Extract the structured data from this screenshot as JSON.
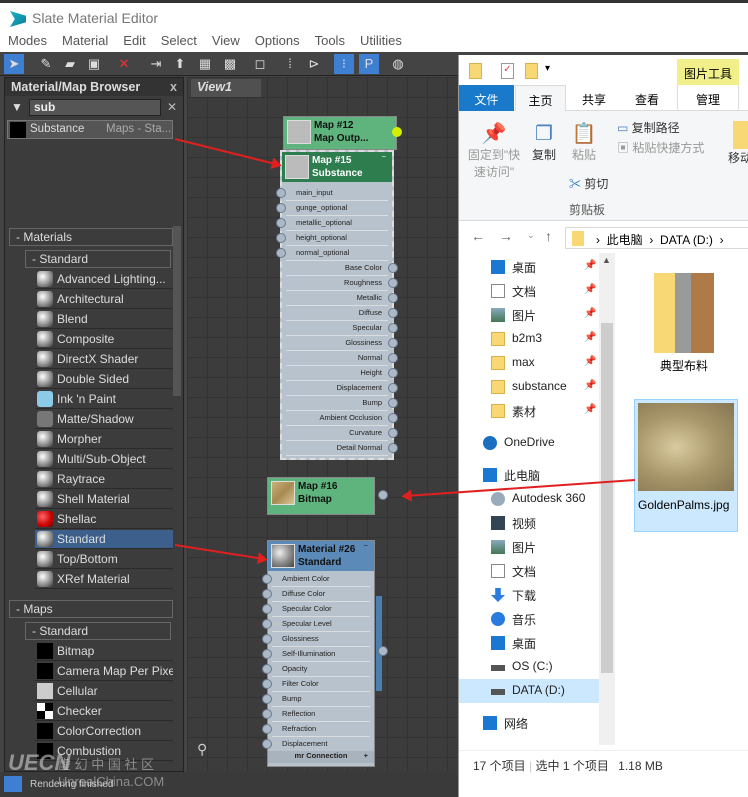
{
  "window": {
    "title": "Slate Material Editor"
  },
  "menu": [
    "Modes",
    "Material",
    "Edit",
    "Select",
    "View",
    "Options",
    "Tools",
    "Utilities"
  ],
  "browser": {
    "title": "Material/Map Browser",
    "close": "x",
    "search_value": "sub",
    "clear": "✕",
    "result": {
      "name": "Substance",
      "category": "Maps - Sta..."
    },
    "materials_group": "- Materials",
    "materials_sub": "- Standard",
    "materials": [
      "Advanced Lighting...",
      "Architectural",
      "Blend",
      "Composite",
      "DirectX Shader",
      "Double Sided",
      "Ink 'n Paint",
      "Matte/Shadow",
      "Morpher",
      "Multi/Sub-Object",
      "Raytrace",
      "Shell Material",
      "Shellac",
      "Standard",
      "Top/Bottom",
      "XRef Material"
    ],
    "selected_material": "Standard",
    "maps_group": "- Maps",
    "maps_sub": "- Standard",
    "maps": [
      "Bitmap",
      "Camera Map Per Pixel",
      "Cellular",
      "Checker",
      "ColorCorrection",
      "Combustion"
    ]
  },
  "view": {
    "tab": "View1",
    "node12": {
      "title": "Map #12",
      "subtitle": "Map Outp..."
    },
    "node15": {
      "title": "Map #15",
      "subtitle": "Substance",
      "inputs": [
        "main_input",
        "gunge_optional",
        "metallic_optional",
        "height_optional",
        "normal_optional"
      ],
      "outputs": [
        "Base Color",
        "Roughness",
        "Metallic",
        "Diffuse",
        "Specular",
        "Glossiness",
        "Normal",
        "Height",
        "Displacement",
        "Bump",
        "Ambient Occlusion",
        "Curvature",
        "Detail Normal"
      ]
    },
    "node16": {
      "title": "Map #16",
      "subtitle": "Bitmap"
    },
    "node26": {
      "title": "Material #26",
      "subtitle": "Standard",
      "inputs": [
        "Ambient Color",
        "Diffuse Color",
        "Specular Color",
        "Specular Level",
        "Glossiness",
        "Self-Illumination",
        "Opacity",
        "Filter Color",
        "Bump",
        "Reflection",
        "Refraction",
        "Displacement"
      ],
      "footer": "mr Connection",
      "footer_icon": "+"
    }
  },
  "status": {
    "text": "Rendering finished"
  },
  "watermark": {
    "logo": "UECN",
    "cn": "虚 幻 中 国 社 区",
    "en": "UnrealChina.COM"
  },
  "explorer": {
    "context_tab": "图片工具",
    "tabs": [
      "文件",
      "主页",
      "共享",
      "查看",
      "管理"
    ],
    "ribbon": {
      "pin": "固定到\"快速访问\"",
      "copy": "复制",
      "paste": "粘贴",
      "copy_path": "复制路径",
      "paste_shortcut": "粘贴快捷方式",
      "cut": "剪切",
      "group": "剪贴板",
      "move": "移动"
    },
    "address": [
      "此电脑",
      "DATA (D:)"
    ],
    "quick_access": [
      {
        "label": "桌面",
        "icon": "desktop"
      },
      {
        "label": "文档",
        "icon": "documents"
      },
      {
        "label": "图片",
        "icon": "pictures"
      },
      {
        "label": "b2m3",
        "icon": "folder"
      },
      {
        "label": "max",
        "icon": "folder"
      },
      {
        "label": "substance",
        "icon": "folder"
      },
      {
        "label": "素材",
        "icon": "folder"
      }
    ],
    "onedrive": "OneDrive",
    "this_pc": "此电脑",
    "pc_items": [
      {
        "label": "Autodesk 360",
        "icon": "cloud"
      },
      {
        "label": "视频",
        "icon": "video"
      },
      {
        "label": "图片",
        "icon": "pictures"
      },
      {
        "label": "文档",
        "icon": "documents"
      },
      {
        "label": "下载",
        "icon": "download"
      },
      {
        "label": "音乐",
        "icon": "music"
      },
      {
        "label": "桌面",
        "icon": "desktop"
      },
      {
        "label": "OS (C:)",
        "icon": "drive"
      },
      {
        "label": "DATA (D:)",
        "icon": "drive"
      }
    ],
    "network": "网络",
    "files": [
      {
        "name": "典型布料",
        "type": "folder"
      },
      {
        "name": "GoldenPalms.jpg",
        "type": "image",
        "selected": true
      }
    ],
    "status": {
      "count": "17 个项目",
      "selection": "选中 1 个项目",
      "size": "1.18 MB"
    }
  },
  "colors": {
    "node_green": "#2e7d4f",
    "node_blue": "#5b89b8",
    "selection": "#cce8ff",
    "arrow": "#e02020"
  }
}
